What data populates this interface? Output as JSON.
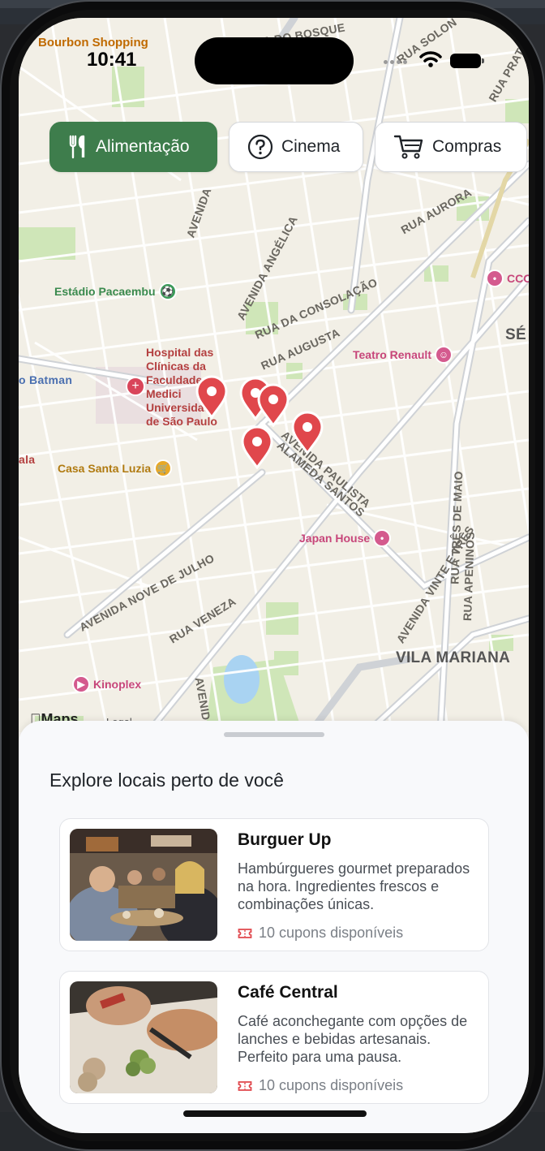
{
  "status": {
    "time": "10:41"
  },
  "map": {
    "labels": {
      "rua_do_bosque": "RUA DO BOSQUE",
      "rua_solon": "RUA SOLON",
      "rua_prates": "RUA PRATES",
      "rua_aurora": "RUA AURORA",
      "avenida_angelica": "AVENIDA ANGÉLICA",
      "rua_consolacao": "RUA DA CONSOLAÇÃO",
      "rua_augusta": "RUA AUGUSTA",
      "avenida_paulista": "AVENIDA PAULISTA",
      "alameda_santos": "ALAMEDA SANTOS",
      "avenida_nove_julho": "AVENIDA NOVE DE JULHO",
      "rua_veneza": "RUA VENEZA",
      "avenida_23_maio": "AVENIDA 23 DE MAIO",
      "rua_apeninos": "RUA APENINOS",
      "rua_tres_maio": "RUA TRÊS DE MAIO",
      "vila_mariana": "VILA MARIANA",
      "se": "SÉ",
      "avenida_vinte_tres": "AVENIDA VINTE E TRÊS",
      "avenida_left": "AVENIDA",
      "avenida_bottom": "AVENIDA"
    },
    "pois": {
      "bourbon": "Bourbon Shopping",
      "pacaembu": "Estádio Pacaembu",
      "hospital": "Hospital das Clínicas da Faculdade de Medicina da Universidade de São Paulo",
      "hospital_lines": [
        "Hospital das",
        "Clínicas da",
        "Faculdade",
        "Medici",
        "Universidade",
        "de São Paulo"
      ],
      "batman": "o Batman",
      "ala": "ala",
      "casa_santa_luzia": "Casa Santa Luzia",
      "teatro_renault": "Teatro Renault",
      "japan_house": "Japan House",
      "kinoplex": "Kinoplex",
      "ccc": "CCC"
    },
    "attribution": {
      "logo": "Maps",
      "legal": "Legal"
    }
  },
  "filters": [
    {
      "label": "Alimentação",
      "icon": "fork-knife-icon",
      "active": true
    },
    {
      "label": "Cinema",
      "icon": "question-circle-icon",
      "active": false
    },
    {
      "label": "Compras",
      "icon": "cart-icon",
      "active": false
    }
  ],
  "sheet": {
    "title": "Explore locais perto de você",
    "places": [
      {
        "name": "Burguer Up",
        "description": "Hambúrgueres gourmet preparados na hora. Ingredientes frescos e combinações únicas.",
        "coupons": "10 cupons disponíveis"
      },
      {
        "name": "Café Central",
        "description": "Café aconchegante com opções de lanches e bebidas artesanais. Perfeito para uma pausa.",
        "coupons": "10 cupons disponíveis"
      }
    ]
  },
  "colors": {
    "accent": "#3e7d4c",
    "pin": "#e0474c",
    "coupon": "#e0474c"
  }
}
